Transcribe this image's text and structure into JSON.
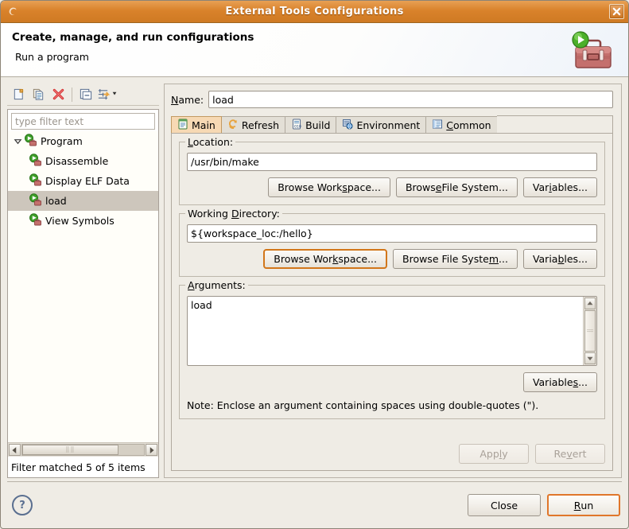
{
  "window": {
    "title": "External Tools Configurations",
    "app_icon": "eclipse-icon",
    "close_label": "✕"
  },
  "header": {
    "title": "Create, manage, and run configurations",
    "subtitle": "Run a program",
    "graphic": "external-tools-toolbox-icon"
  },
  "toolbar": {
    "buttons": [
      {
        "name": "new-launch-configuration",
        "icon": "new-document-icon"
      },
      {
        "name": "duplicate-launch-configuration",
        "icon": "copy-document-icon"
      },
      {
        "name": "delete-launch-configuration",
        "icon": "red-x-delete-icon"
      },
      {
        "name": "collapse-all",
        "icon": "collapse-all-icon"
      },
      {
        "name": "filter-menu",
        "icon": "filter-icon"
      }
    ]
  },
  "filter": {
    "placeholder": "type filter text",
    "value": "",
    "status": "Filter matched 5 of 5 items"
  },
  "tree": {
    "items": [
      {
        "label": "Program",
        "level": 0,
        "expanded": true,
        "selected": false,
        "icon": "program-run-icon"
      },
      {
        "label": "Disassemble",
        "level": 1,
        "expanded": false,
        "selected": false,
        "icon": "program-run-icon"
      },
      {
        "label": "Display ELF Data",
        "level": 1,
        "expanded": false,
        "selected": false,
        "icon": "program-run-icon"
      },
      {
        "label": "load",
        "level": 1,
        "expanded": false,
        "selected": true,
        "icon": "program-run-icon"
      },
      {
        "label": "View Symbols",
        "level": 1,
        "expanded": false,
        "selected": false,
        "icon": "program-run-icon"
      }
    ]
  },
  "config": {
    "name_label": "Name:",
    "name_label_mnemonic": "N",
    "name_value": "load",
    "tabs": [
      {
        "label": "Main",
        "mnemonic": "",
        "icon": "main-document-icon",
        "active": true
      },
      {
        "label": "Refresh",
        "mnemonic": "",
        "icon": "refresh-arrows-icon",
        "active": false
      },
      {
        "label": "Build",
        "mnemonic": "",
        "icon": "build-binary-icon",
        "active": false
      },
      {
        "label": "Environment",
        "mnemonic": "",
        "icon": "environment-icon",
        "active": false
      },
      {
        "label": "Common",
        "mnemonic": "C",
        "icon": "common-list-icon",
        "active": false
      }
    ],
    "location": {
      "label": "Location:",
      "label_mnemonic": "L",
      "value": "/usr/bin/make",
      "buttons": [
        {
          "pre": "Browse Work",
          "mn": "s",
          "post": "pace...",
          "name": "browse-workspace-button",
          "focused": false
        },
        {
          "pre": "Brows",
          "mn": "e",
          "post": " File System...",
          "name": "browse-file-system-button",
          "focused": false
        },
        {
          "pre": "Var",
          "mn": "i",
          "post": "ables...",
          "name": "variables-button",
          "focused": false
        }
      ]
    },
    "working_directory": {
      "label": "Working Directory:",
      "label_mnemonic": "D",
      "value": "${workspace_loc:/hello}",
      "buttons": [
        {
          "pre": "Browse Wor",
          "mn": "k",
          "post": "space...",
          "name": "browse-workspace-button",
          "focused": true
        },
        {
          "pre": "Browse File Syste",
          "mn": "m",
          "post": "...",
          "name": "browse-file-system-button",
          "focused": false
        },
        {
          "pre": "Varia",
          "mn": "b",
          "post": "les...",
          "name": "variables-button",
          "focused": false
        }
      ]
    },
    "arguments": {
      "label": "Arguments:",
      "label_mnemonic": "A",
      "value": "load",
      "variables_button": {
        "pre": "Variable",
        "mn": "s",
        "post": "...",
        "name": "variables-button"
      },
      "note": "Note: Enclose an argument containing spaces using double-quotes (\")."
    }
  },
  "actions": {
    "apply": {
      "pre": "App",
      "mn": "l",
      "post": "y",
      "disabled": true
    },
    "revert": {
      "pre": "Re",
      "mn": "v",
      "post": "ert",
      "disabled": true
    },
    "close": {
      "pre": "Close",
      "mn": "",
      "post": "",
      "default": false
    },
    "run": {
      "pre": "",
      "mn": "R",
      "post": "un",
      "default": true
    }
  },
  "help": {
    "label": "?"
  },
  "colors": {
    "titlebar": "#d9822b",
    "accent_focus": "#d2761a",
    "default_button_border": "#e0762a",
    "dialog_bg": "#efece5",
    "active_tab_bg": "#f7d9b4",
    "tree_selection": "#cdc6bc"
  }
}
